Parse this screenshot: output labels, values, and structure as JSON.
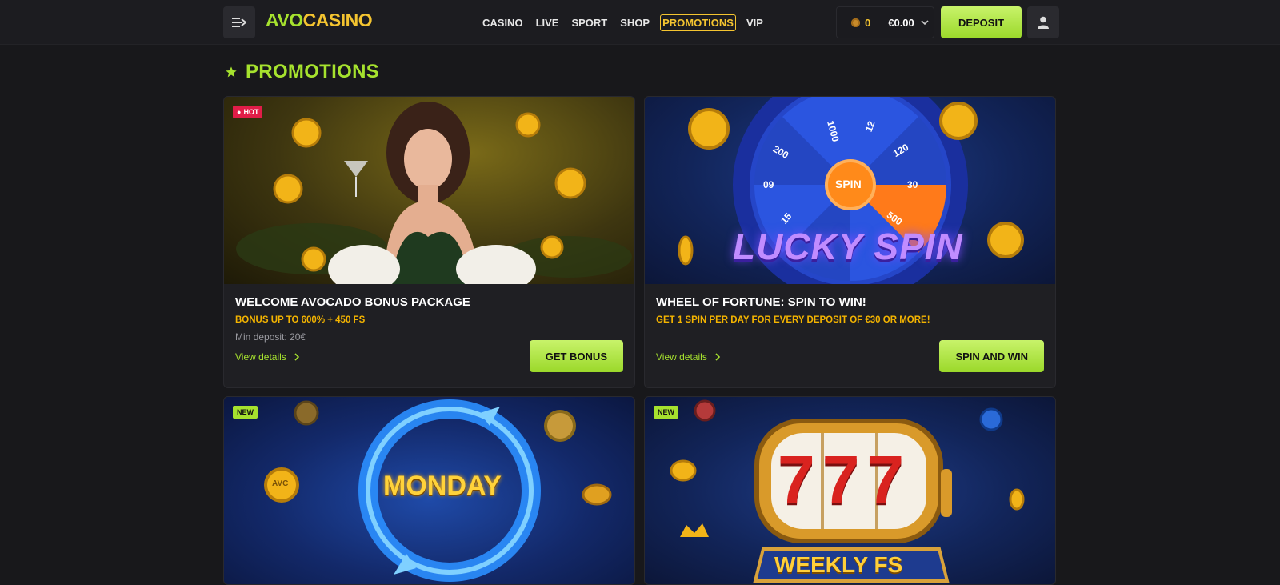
{
  "header": {
    "logo_part1": "AVO",
    "logo_part2": "CASINO",
    "nav": [
      {
        "label": "CASINO"
      },
      {
        "label": "LIVE"
      },
      {
        "label": "SPORT"
      },
      {
        "label": "SHOP"
      },
      {
        "label": "PROMOTIONS",
        "active": true
      },
      {
        "label": "VIP"
      }
    ],
    "coins": "0",
    "balance": "€0.00",
    "deposit_label": "DEPOSIT"
  },
  "page": {
    "title": "PROMOTIONS"
  },
  "promotions": [
    {
      "badge": "HOT",
      "title": "WELCOME AVOCADO BONUS PACKAGE",
      "subtitle": "BONUS UP TO 600% + 450 FS",
      "note": "Min deposit: 20€",
      "details_label": "View details",
      "cta_label": "GET BONUS"
    },
    {
      "badge": "",
      "title": "WHEEL OF FORTUNE: SPIN TO WIN!",
      "subtitle": "GET 1 SPIN PER DAY FOR EVERY DEPOSIT OF €30 OR MORE!",
      "note": "",
      "details_label": "View details",
      "cta_label": "SPIN AND WIN",
      "banner_text": "LUCKY SPIN",
      "wheel": {
        "center": "SPIN",
        "segments": [
          "1000",
          "12",
          "120",
          "30",
          "500",
          "15",
          "09",
          "200"
        ]
      }
    },
    {
      "badge": "NEW",
      "banner_text": "MONDAY",
      "coin_label": "AVC"
    },
    {
      "badge": "NEW",
      "banner_text": "WEEKLY FS",
      "reels": "777"
    }
  ],
  "colors": {
    "accent_green": "#a6e22e",
    "accent_gold": "#f4c430",
    "hot_red": "#e11d48"
  }
}
